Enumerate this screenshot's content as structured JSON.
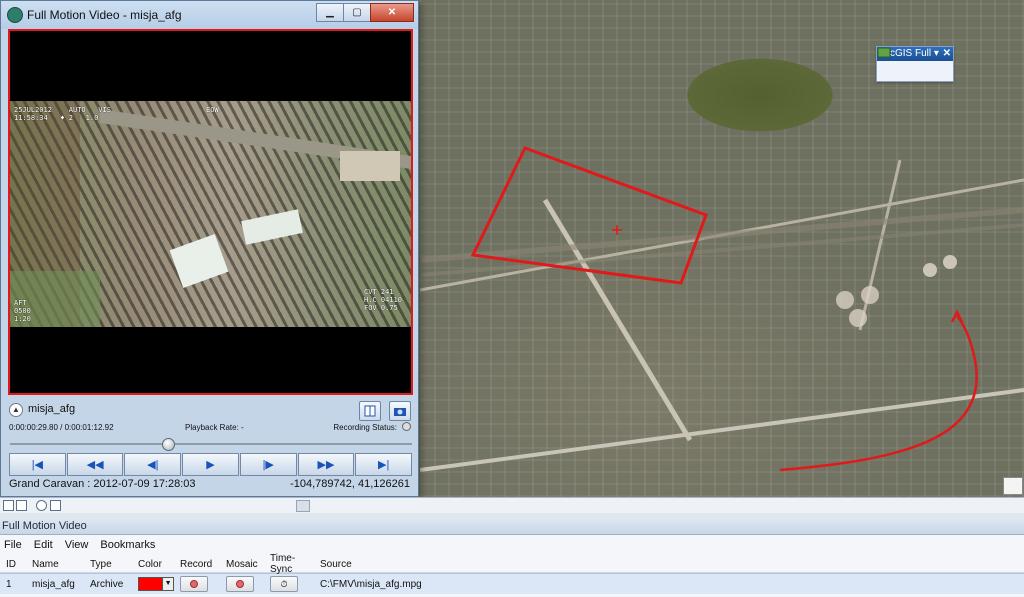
{
  "window": {
    "title": "Full Motion Video - misja_afg",
    "controls": [
      "minimize-icon",
      "maximize-icon",
      "close-icon"
    ]
  },
  "video": {
    "osd_top_left": "25JUL2012    AUTO   VIS\n11:58:34   ♦ 2   1.0",
    "osd_top_center": "EOW",
    "osd_top_right": "",
    "osd_bottom_left": "AFT\n0500\n1:20",
    "osd_bottom_right": "CVT 241\nH.C 04110\nFOV 0.75"
  },
  "player": {
    "clip_name": "misja_afg",
    "time": "0:00:00:29.80 / 0:00:01:12.92",
    "playback_rate_label": "Playback Rate: -",
    "recording_status_label": "Recording Status:",
    "progress_fraction": 0.39,
    "transport": [
      "skip-start-icon",
      "rewind-icon",
      "step-back-icon",
      "play-icon",
      "step-forward-icon",
      "fast-forward-icon",
      "skip-end-icon"
    ],
    "platform": "Grand Caravan : 2012-07-09 17:28:03",
    "coords": "-104,789742, 41,126261"
  },
  "arcgis_toolbar": {
    "title": "ArcGIS Full ▾",
    "icons": [
      "video-camera-icon",
      "add-layer-icon",
      "monitor-icon",
      "sync-icon"
    ]
  },
  "colors": {
    "footprint": "#e01a1a",
    "track": "#e01a1a"
  },
  "pane": {
    "title": "Full Motion Video",
    "menus": [
      "File",
      "Edit",
      "View",
      "Bookmarks"
    ],
    "columns": [
      "ID",
      "Name",
      "Type",
      "Color",
      "Record",
      "Mosaic",
      "Time-Sync",
      "Source"
    ],
    "rows": [
      {
        "id": "1",
        "name": "misja_afg",
        "type": "Archive",
        "color": "#ff0000",
        "source": "C:\\FMV\\misja_afg.mpg"
      }
    ]
  }
}
